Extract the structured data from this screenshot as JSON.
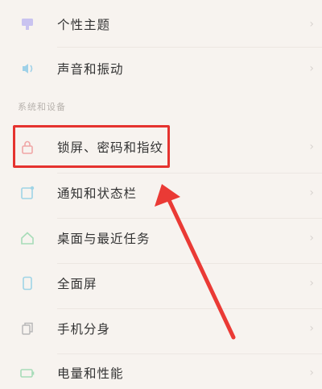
{
  "settings": {
    "top_items": [
      {
        "label": "个性主题",
        "icon": "theme-icon"
      },
      {
        "label": "声音和振动",
        "icon": "sound-icon"
      }
    ],
    "section_title": "系统和设备",
    "system_items": [
      {
        "label": "锁屏、密码和指纹",
        "icon": "lock-icon"
      },
      {
        "label": "通知和状态栏",
        "icon": "notification-icon"
      },
      {
        "label": "桌面与最近任务",
        "icon": "home-icon"
      },
      {
        "label": "全面屏",
        "icon": "fullscreen-icon"
      },
      {
        "label": "手机分身",
        "icon": "clone-icon"
      },
      {
        "label": "电量和性能",
        "icon": "battery-icon"
      }
    ],
    "chevron": "›"
  },
  "annotation": {
    "highlight_color": "#e5332f",
    "arrow_color": "#ea3a35",
    "target": "锁屏、密码和指纹"
  }
}
